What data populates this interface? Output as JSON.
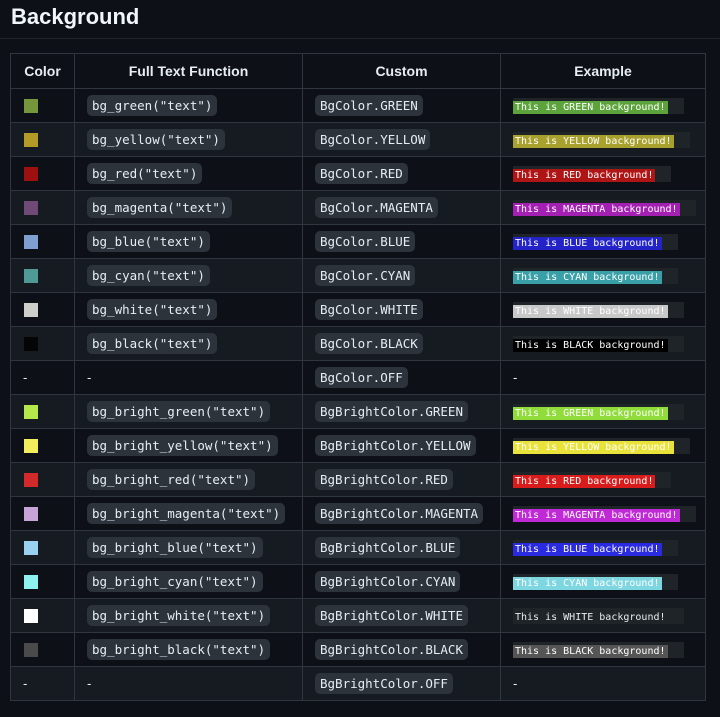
{
  "title": "Background",
  "columns": [
    "Color",
    "Full Text Function",
    "Custom",
    "Example"
  ],
  "rows": [
    {
      "swatch": "#75963a",
      "func": "bg_green(\"text\")",
      "custom": "BgColor.GREEN",
      "example": "This is GREEN background!",
      "ex_bg": "#5ba33a",
      "ex_fg": "#ffffff"
    },
    {
      "swatch": "#b49a27",
      "func": "bg_yellow(\"text\")",
      "custom": "BgColor.YELLOW",
      "example": "This is YELLOW background!",
      "ex_bg": "#a8a12e",
      "ex_fg": "#ffffff"
    },
    {
      "swatch": "#9e0f0f",
      "func": "bg_red(\"text\")",
      "custom": "BgColor.RED",
      "example": "This is RED background!",
      "ex_bg": "#b01515",
      "ex_fg": "#ffffff"
    },
    {
      "swatch": "#6f4a77",
      "func": "bg_magenta(\"text\")",
      "custom": "BgColor.MAGENTA",
      "example": "This is MAGENTA background!",
      "ex_bg": "#a320b3",
      "ex_fg": "#ffffff"
    },
    {
      "swatch": "#7e9fd0",
      "func": "bg_blue(\"text\")",
      "custom": "BgColor.BLUE",
      "example": "This is BLUE background!",
      "ex_bg": "#2323c8",
      "ex_fg": "#ffffff"
    },
    {
      "swatch": "#4f9a97",
      "func": "bg_cyan(\"text\")",
      "custom": "BgColor.CYAN",
      "example": "This is CYAN background!",
      "ex_bg": "#3aa0a8",
      "ex_fg": "#ffffff"
    },
    {
      "swatch": "#cfcfca",
      "func": "bg_white(\"text\")",
      "custom": "BgColor.WHITE",
      "example": "This is WHITE background!",
      "ex_bg": "#c8c8c8",
      "ex_fg": "#ffffff"
    },
    {
      "swatch": "#050505",
      "func": "bg_black(\"text\")",
      "custom": "BgColor.BLACK",
      "example": "This is BLACK background!",
      "ex_bg": "#000000",
      "ex_fg": "#ffffff"
    },
    {
      "swatch": "",
      "swatch_text": "-",
      "func_text": "-",
      "custom": "BgColor.OFF",
      "example_text": "-"
    },
    {
      "swatch": "#b5e84a",
      "func": "bg_bright_green(\"text\")",
      "custom": "BgBrightColor.GREEN",
      "example": "This is GREEN background!",
      "ex_bg": "#8fdc3a",
      "ex_fg": "#ffffff"
    },
    {
      "swatch": "#f3ee5c",
      "func": "bg_bright_yellow(\"text\")",
      "custom": "BgBrightColor.YELLOW",
      "example": "This is YELLOW background!",
      "ex_bg": "#e8e23a",
      "ex_fg": "#ffffff"
    },
    {
      "swatch": "#d22a2a",
      "func": "bg_bright_red(\"text\")",
      "custom": "BgBrightColor.RED",
      "example": "This is RED background!",
      "ex_bg": "#d81c1c",
      "ex_fg": "#ffffff"
    },
    {
      "swatch": "#c6a4d8",
      "func": "bg_bright_magenta(\"text\")",
      "custom": "BgBrightColor.MAGENTA",
      "example": "This is MAGENTA background!",
      "ex_bg": "#c02ad6",
      "ex_fg": "#ffffff"
    },
    {
      "swatch": "#9ad0f0",
      "func": "bg_bright_blue(\"text\")",
      "custom": "BgBrightColor.BLUE",
      "example": "This is BLUE background!",
      "ex_bg": "#2a2ae0",
      "ex_fg": "#ffffff"
    },
    {
      "swatch": "#8ff0f0",
      "func": "bg_bright_cyan(\"text\")",
      "custom": "BgBrightColor.CYAN",
      "example": "This is CYAN background!",
      "ex_bg": "#7ed6e0",
      "ex_fg": "#ffffff"
    },
    {
      "swatch": "#ffffff",
      "func": "bg_bright_white(\"text\")",
      "custom": "BgBrightColor.WHITE",
      "example": "This is WHITE background!",
      "ex_bg": "#1f2428",
      "ex_fg": "#e6edf3"
    },
    {
      "swatch": "#4a4a4a",
      "func": "bg_bright_black(\"text\")",
      "custom": "BgBrightColor.BLACK",
      "example": "This is BLACK background!",
      "ex_bg": "#555555",
      "ex_fg": "#ffffff"
    },
    {
      "swatch": "",
      "swatch_text": "-",
      "func_text": "-",
      "custom": "BgBrightColor.OFF",
      "example_text": "-"
    }
  ]
}
